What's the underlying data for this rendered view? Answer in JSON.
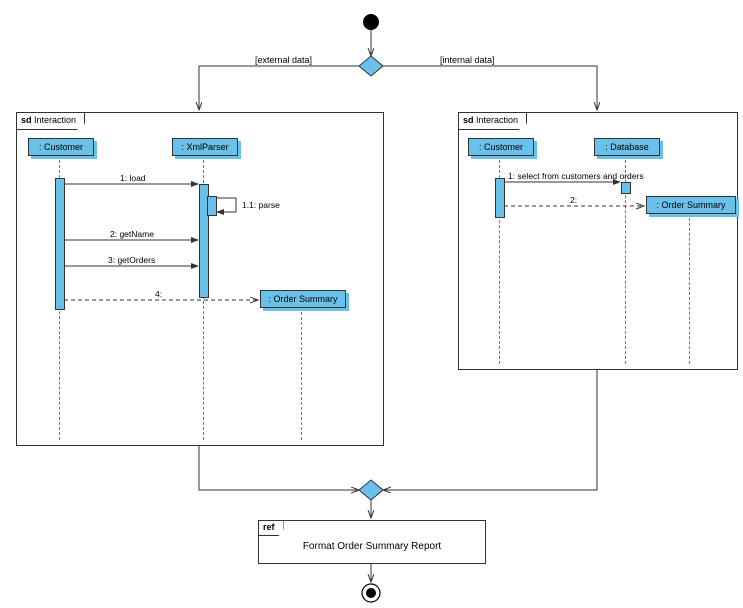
{
  "initial_node": "",
  "guards": {
    "left": "[external data]",
    "right": "[internal data]"
  },
  "left_frame": {
    "label_prefix": "sd",
    "label": "Interaction",
    "lifelines": {
      "customer": ": Customer",
      "xmlparser": ": XmlParser",
      "ordersummary": ": Order Summary"
    },
    "messages": {
      "m1": "1: load",
      "m1_1": "1.1: parse",
      "m2": "2: getName",
      "m3": "3: getOrders",
      "m4": "4:"
    }
  },
  "right_frame": {
    "label_prefix": "sd",
    "label": "Interaction",
    "lifelines": {
      "customer": ": Customer",
      "database": ": Database",
      "ordersummary": ": Order Summary"
    },
    "messages": {
      "m1": "1: select from customers and orders",
      "m2": "2:"
    }
  },
  "ref": {
    "tab": "ref",
    "text": "Format Order Summary Report"
  }
}
